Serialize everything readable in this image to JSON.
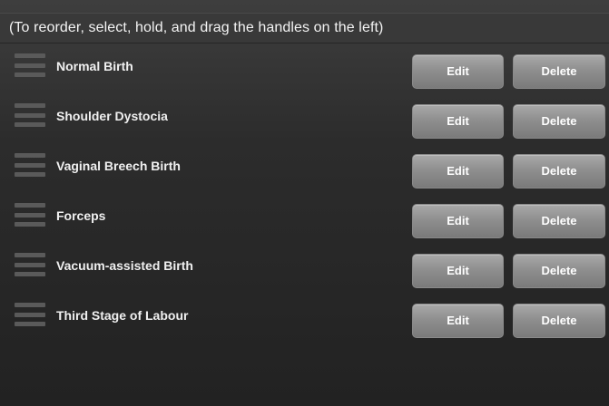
{
  "header": {
    "instructions": "(To reorder, select, hold, and drag the handles on the left)"
  },
  "rows": [
    {
      "label": "Normal Birth",
      "edit_label": "Edit",
      "delete_label": "Delete"
    },
    {
      "label": "Shoulder Dystocia",
      "edit_label": "Edit",
      "delete_label": "Delete"
    },
    {
      "label": "Vaginal Breech Birth",
      "edit_label": "Edit",
      "delete_label": "Delete"
    },
    {
      "label": "Forceps",
      "edit_label": "Edit",
      "delete_label": "Delete"
    },
    {
      "label": "Vacuum-assisted Birth",
      "edit_label": "Edit",
      "delete_label": "Delete"
    },
    {
      "label": "Third Stage of Labour",
      "edit_label": "Edit",
      "delete_label": "Delete"
    }
  ]
}
